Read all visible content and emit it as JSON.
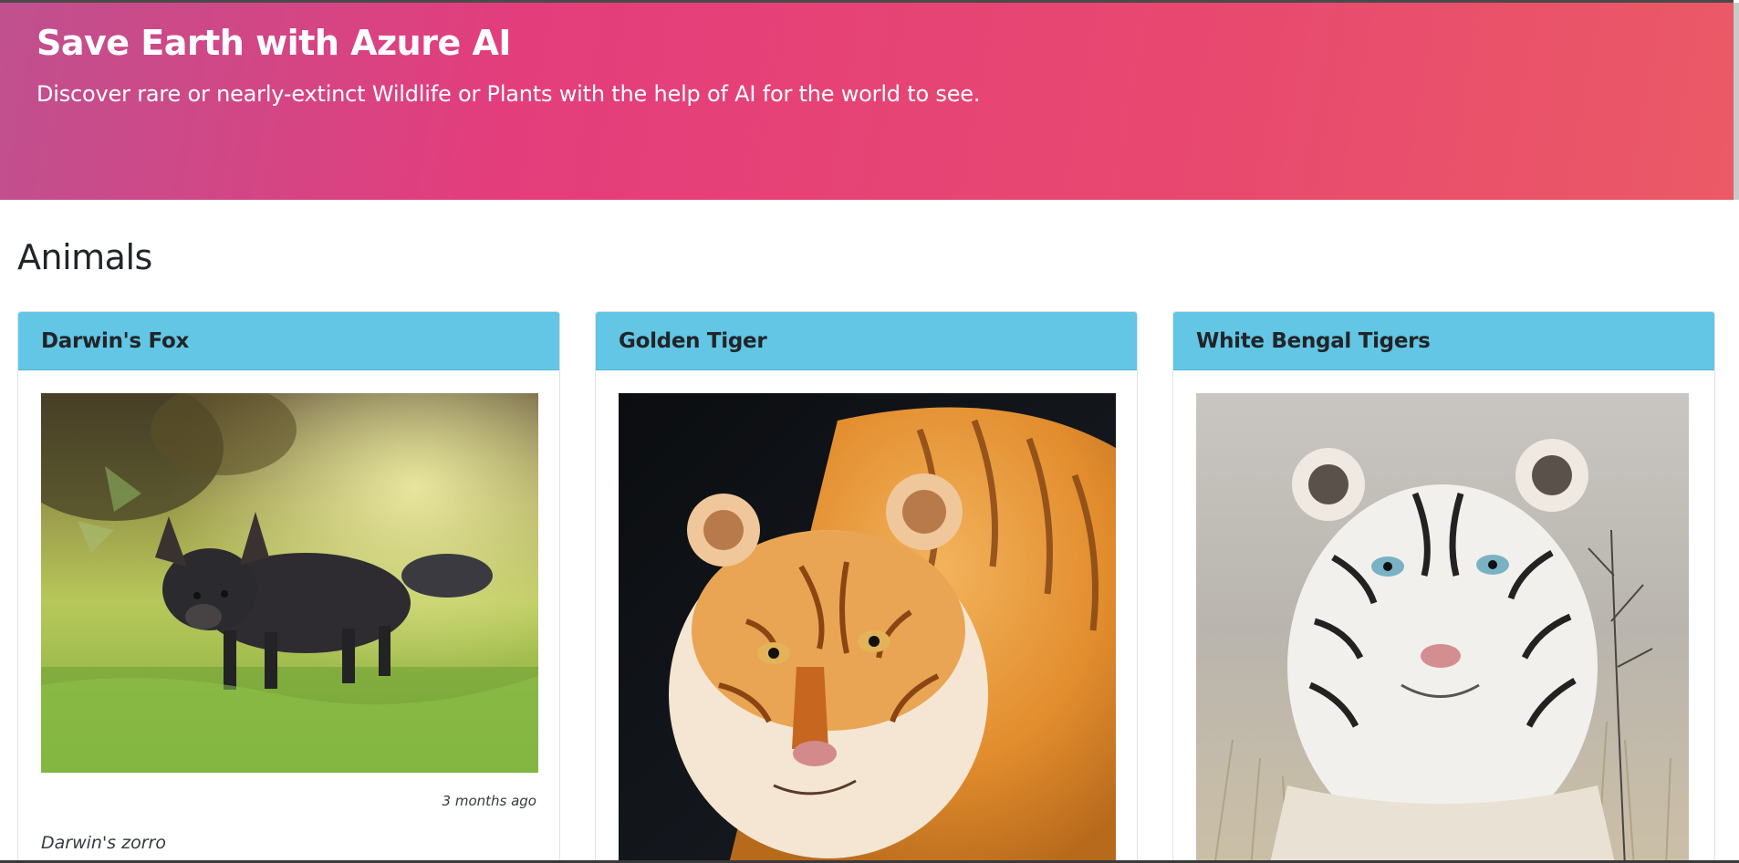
{
  "hero": {
    "title": "Save Earth with Azure AI",
    "subtitle": "Discover rare or nearly-extinct Wildlife or Plants with the help of AI for the world to see."
  },
  "section": {
    "title": "Animals"
  },
  "cards": [
    {
      "title": "Darwin's Fox",
      "image": "darwins-fox-photo",
      "time": "3 months ago",
      "description": "Darwin's zorro"
    },
    {
      "title": "Golden Tiger",
      "image": "golden-tiger-photo"
    },
    {
      "title": "White Bengal Tigers",
      "image": "white-bengal-tiger-photo"
    }
  ],
  "colors": {
    "hero_gradient_start": "#c0508f",
    "hero_gradient_mid": "#e43d7c",
    "hero_gradient_end": "#eb5a66",
    "card_header": "#62c6e4"
  }
}
